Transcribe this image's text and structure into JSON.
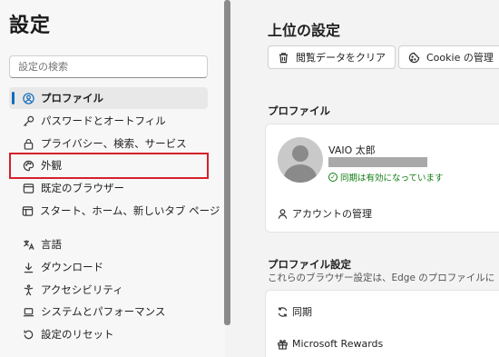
{
  "sidebar": {
    "title": "設定",
    "search_placeholder": "設定の検索",
    "items": [
      {
        "label": "プロファイル",
        "icon": "profile-icon",
        "active": true
      },
      {
        "label": "パスワードとオートフィル",
        "icon": "key-icon"
      },
      {
        "label": "プライバシー、検索、サービス",
        "icon": "lock-icon"
      },
      {
        "label": "外観",
        "icon": "palette-icon",
        "highlighted": true
      },
      {
        "label": "既定のブラウザー",
        "icon": "browser-icon"
      },
      {
        "label": "スタート、ホーム、新しいタブ ページ",
        "icon": "home-page-icon"
      },
      {
        "label": "言語",
        "icon": "language-icon"
      },
      {
        "label": "ダウンロード",
        "icon": "download-icon"
      },
      {
        "label": "アクセシビリティ",
        "icon": "accessibility-icon"
      },
      {
        "label": "システムとパフォーマンス",
        "icon": "laptop-icon"
      },
      {
        "label": "設定のリセット",
        "icon": "reset-icon"
      }
    ]
  },
  "main": {
    "title": "上位の設定",
    "clear_data_button": "閲覧データをクリア",
    "cookie_button": "Cookie の管理",
    "profile_section_title": "プロファイル",
    "profile_name": "VAIO 太郎",
    "sync_status": "同期は有効になっています",
    "account_manage": "アカウントの管理",
    "profile_settings_title": "プロファイル設定",
    "profile_settings_desc": "これらのブラウザー設定は、Edge のプロファイルに",
    "sync_label": "同期",
    "rewards_label": "Microsoft Rewards"
  },
  "colors": {
    "accent": "#0f6cbd",
    "highlight_box": "#d5202c",
    "sync_ok": "#107c10"
  }
}
